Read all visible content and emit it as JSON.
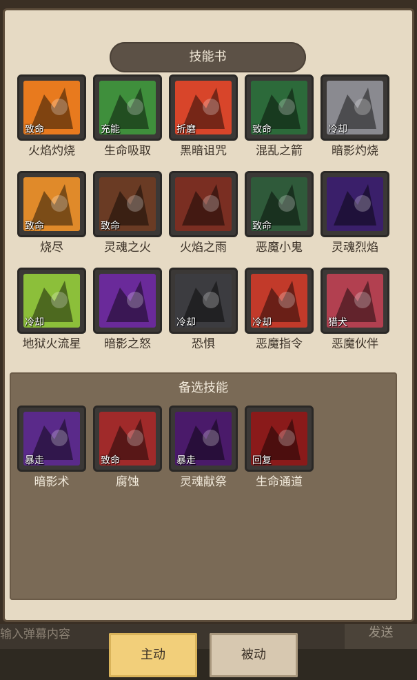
{
  "title": "技能书",
  "skills": [
    {
      "name": "火焰灼烧",
      "tag": "致命",
      "icon": "fire-hand-icon",
      "bg": "#e87a1e"
    },
    {
      "name": "生命吸取",
      "tag": "充能",
      "icon": "green-claw-icon",
      "bg": "#3f8f3c"
    },
    {
      "name": "黑暗诅咒",
      "tag": "折磨",
      "icon": "cursed-sigil-icon",
      "bg": "#d8452a"
    },
    {
      "name": "混乱之箭",
      "tag": "致命",
      "icon": "chaos-demon-icon",
      "bg": "#2c6a3a"
    },
    {
      "name": "暗影灼烧",
      "tag": "冷却",
      "icon": "shadow-fist-icon",
      "bg": "#8a8a90"
    },
    {
      "name": "烧尽",
      "tag": "致命",
      "icon": "burning-rock-icon",
      "bg": "#e08a2a"
    },
    {
      "name": "灵魂之火",
      "tag": "致命",
      "icon": "soul-fireball-icon",
      "bg": "#6a3b24"
    },
    {
      "name": "火焰之雨",
      "tag": "",
      "icon": "fire-rain-icon",
      "bg": "#7a2e22"
    },
    {
      "name": "恶魔小鬼",
      "tag": "致命",
      "icon": "imp-icon",
      "bg": "#2f5a3a"
    },
    {
      "name": "灵魂烈焰",
      "tag": "",
      "icon": "blue-soul-flame-icon",
      "bg": "#3a1f6a"
    },
    {
      "name": "地狱火流星",
      "tag": "冷却",
      "icon": "infernal-meteor-icon",
      "bg": "#8cbf3a"
    },
    {
      "name": "暗影之怒",
      "tag": "",
      "icon": "shadow-spiral-icon",
      "bg": "#6a2a9a"
    },
    {
      "name": "恐惧",
      "tag": "冷却",
      "icon": "fear-ghost-icon",
      "bg": "#3c3c40"
    },
    {
      "name": "恶魔指令",
      "tag": "冷却",
      "icon": "demon-lord-icon",
      "bg": "#c23a2a"
    },
    {
      "name": "恶魔伙伴",
      "tag": "猎犬",
      "icon": "felhound-icon",
      "bg": "#b24050"
    }
  ],
  "alt_title": "备选技能",
  "alt_skills": [
    {
      "name": "暗影术",
      "tag": "暴走",
      "icon": "shadow-staff-icon",
      "bg": "#5a2a8a"
    },
    {
      "name": "腐蚀",
      "tag": "致命",
      "icon": "corruption-icon",
      "bg": "#a02a2a"
    },
    {
      "name": "灵魂献祭",
      "tag": "暴走",
      "icon": "raven-icon",
      "bg": "#4a1a6a"
    },
    {
      "name": "生命通道",
      "tag": "回复",
      "icon": "life-tap-icon",
      "bg": "#8a1a1a"
    }
  ],
  "chat": {
    "placeholder": "输入弹幕内容",
    "send": "发送"
  },
  "tabs": {
    "active": "主动",
    "passive": "被动"
  }
}
